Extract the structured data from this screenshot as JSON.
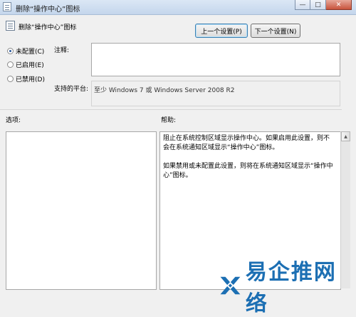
{
  "window": {
    "title": "删除“操作中心”图标",
    "minimize_glyph": "—",
    "maximize_glyph": "□",
    "close_glyph": "✕"
  },
  "header": {
    "setting_title": "删除“操作中心”图标",
    "prev_button": "上一个设置(P)",
    "next_button": "下一个设置(N)"
  },
  "state_options": [
    {
      "label": "未配置(C)",
      "selected": true
    },
    {
      "label": "已启用(E)",
      "selected": false
    },
    {
      "label": "已禁用(D)",
      "selected": false
    }
  ],
  "comment": {
    "label": "注释:",
    "value": ""
  },
  "platform": {
    "label": "支持的平台:",
    "value": "至少 Windows 7 或 Windows Server 2008 R2"
  },
  "options": {
    "label": "选项:"
  },
  "help": {
    "label": "帮助:",
    "paragraphs": [
      "阻止在系统控制区域显示操作中心。如果启用此设置，则不会在系统通知区域显示“操作中心”图标。",
      "如果禁用或未配置此设置，则将在系统通知区域显示“操作中心”图标。"
    ]
  },
  "watermark": {
    "text": "易企推网络"
  }
}
